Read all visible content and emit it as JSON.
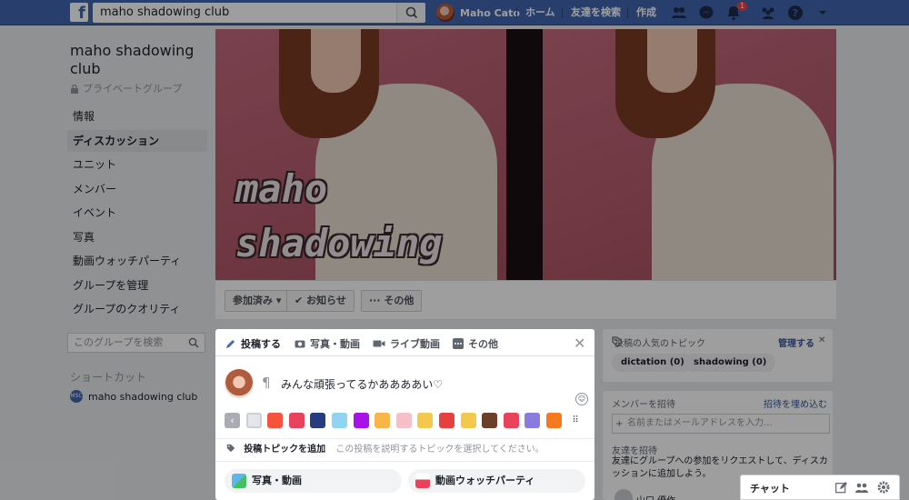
{
  "topbar": {
    "logo": "f",
    "search_value": "maho shadowing club",
    "user_name": "Maho Cato",
    "home": "ホーム",
    "find_friends": "友達を検索",
    "create": "作成",
    "notif_count": "1"
  },
  "group": {
    "name": "maho shadowing club",
    "privacy": "プライベートグループ"
  },
  "sidebar": {
    "items": [
      {
        "label": "情報"
      },
      {
        "label": "ディスカッション"
      },
      {
        "label": "ユニット"
      },
      {
        "label": "メンバー"
      },
      {
        "label": "イベント"
      },
      {
        "label": "写真"
      },
      {
        "label": "動画ウォッチパーティ"
      },
      {
        "label": "グループを管理"
      },
      {
        "label": "グループのクオリティ"
      }
    ],
    "group_search_placeholder": "このグループを検索",
    "shortcuts_title": "ショートカット",
    "shortcut_item": "maho shadowing club",
    "shortcut_avatar_text": "MSC"
  },
  "cover": {
    "text": "maho\nshadowing\nclub"
  },
  "action_bar": {
    "joined": "参加済み ▾",
    "notifications": "✔ お知らせ",
    "more": "··· その他"
  },
  "composer": {
    "tabs": [
      "投稿する",
      "写真・動画",
      "ライブ動画",
      "その他"
    ],
    "text": "みんな頑張ってるかああああい♡",
    "topic_label": "投稿トピックを追加",
    "topic_hint": "この投稿を説明するトピックを選択してください。",
    "photo_video": "写真・動画",
    "watch_party": "動画ウォッチパーティ",
    "backgrounds": [
      "#a9adb3",
      "#e4e6eb",
      "#f5533d",
      "#e8435b",
      "#263b80",
      "#8fd4f0",
      "#a811e8",
      "#f7b54a",
      "#f5c0c9",
      "#f2c94c",
      "#e64040",
      "#f2c94c",
      "#6b3f2a",
      "#e8435b",
      "#8a7be0",
      "#f57a1f",
      "#4b4f56"
    ]
  },
  "topics_panel": {
    "title": "投稿の人気のトピック",
    "manage": "管理する",
    "close": "✕",
    "topics": [
      "dictation (0)",
      "shadowing (0)"
    ]
  },
  "members_panel": {
    "invite_title": "メンバーを招待",
    "embed_link": "招待を埋め込む",
    "invite_placeholder": "名前またはメールアドレスを入力...",
    "friends_title": "友達を招待",
    "friends_desc": "友達にグループへの参加をリクエストして、ディスカッションに追加しよう。",
    "member_name": "山口 優作"
  },
  "chat": {
    "label": "チャット"
  },
  "colors": {
    "fb_blue": "#4267b2",
    "link": "#385898"
  }
}
